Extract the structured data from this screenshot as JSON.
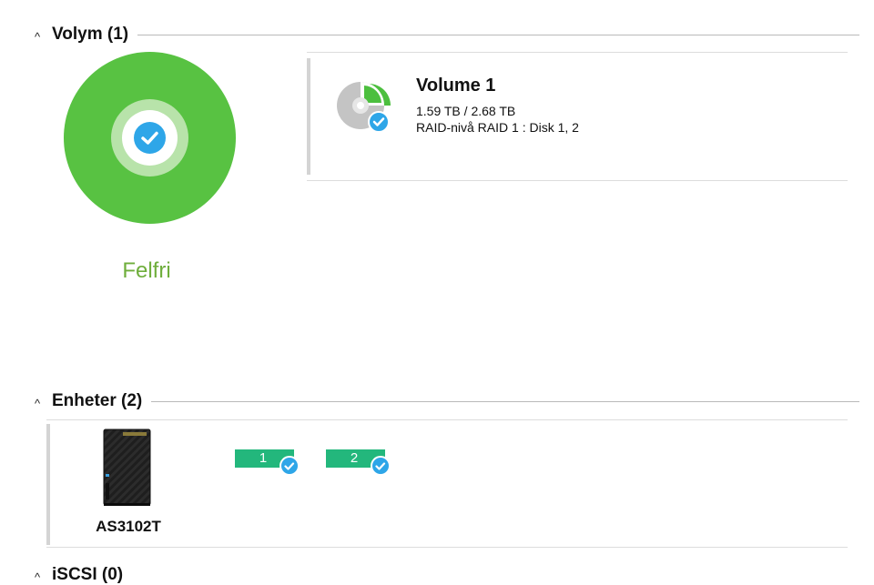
{
  "volume_section": {
    "title": "Volym (1)",
    "status": "Felfri",
    "status_color": "#58c242",
    "volume": {
      "name": "Volume 1",
      "capacity": "1.59 TB / 2.68 TB",
      "raid": "RAID-nivå RAID 1 : Disk 1, 2",
      "used_fraction": 0.593
    }
  },
  "devices_section": {
    "title": "Enheter (2)",
    "device": {
      "model": "AS3102T",
      "disks": [
        {
          "label": "1",
          "status_icon": "check-icon"
        },
        {
          "label": "2",
          "status_icon": "check-icon"
        }
      ]
    },
    "disk_color": "#23b77c"
  },
  "iscsi_section": {
    "title": "iSCSI (0)"
  },
  "accent_check_color": "#2ea6e8"
}
